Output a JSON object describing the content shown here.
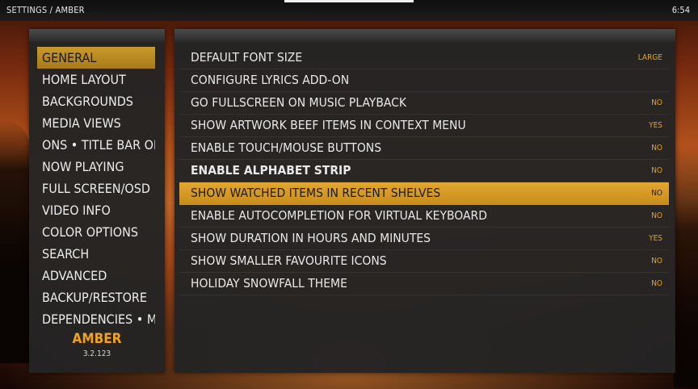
{
  "topbar": {
    "breadcrumb": "SETTINGS / AMBER",
    "time": "6:54"
  },
  "categories": [
    {
      "label": "GENERAL",
      "active": true
    },
    {
      "label": "HOME LAYOUT"
    },
    {
      "label": "BACKGROUNDS"
    },
    {
      "label": "MEDIA VIEWS"
    },
    {
      "label": "ONS • TITLE BAR OF"
    },
    {
      "label": "NOW PLAYING"
    },
    {
      "label": "FULL SCREEN/OSD"
    },
    {
      "label": "VIDEO INFO"
    },
    {
      "label": "COLOR OPTIONS"
    },
    {
      "label": "SEARCH"
    },
    {
      "label": "ADVANCED"
    },
    {
      "label": "BACKUP/RESTORE"
    },
    {
      "label": "DEPENDENCIES • M"
    }
  ],
  "skin": {
    "name": "AMBER",
    "version": "3.2.123"
  },
  "settings": [
    {
      "label": "DEFAULT FONT SIZE",
      "value": "LARGE"
    },
    {
      "label": "CONFIGURE LYRICS ADD-ON",
      "value": ""
    },
    {
      "label": "GO FULLSCREEN ON MUSIC PLAYBACK",
      "value": "NO"
    },
    {
      "label": "SHOW ARTWORK BEEF ITEMS IN CONTEXT MENU",
      "value": "YES"
    },
    {
      "label": "ENABLE TOUCH/MOUSE BUTTONS",
      "value": "NO"
    },
    {
      "label": "ENABLE ALPHABET STRIP",
      "value": "NO",
      "bold": true
    },
    {
      "label": "SHOW WATCHED ITEMS IN RECENT SHELVES",
      "value": "NO",
      "focused": true
    },
    {
      "label": "ENABLE AUTOCOMPLETION FOR VIRTUAL KEYBOARD",
      "value": "NO"
    },
    {
      "label": "SHOW DURATION IN HOURS AND MINUTES",
      "value": "YES"
    },
    {
      "label": "SHOW SMALLER FAVOURITE ICONS",
      "value": "NO"
    },
    {
      "label": "HOLIDAY SNOWFALL THEME",
      "value": "NO"
    }
  ],
  "colors": {
    "accent": "#e2a72f",
    "value_text": "#e8a21e",
    "panel": "#242424"
  }
}
